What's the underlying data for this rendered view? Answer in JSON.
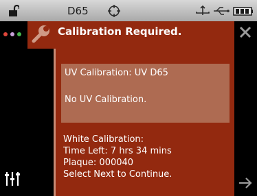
{
  "status_bar": {
    "illuminant": "D65",
    "icons": [
      "unlock-icon",
      "target-icon",
      "usb-icon",
      "usb-plug-icon",
      "battery-icon"
    ]
  },
  "left_rail": {
    "icons": [
      "color-dots-icon",
      "sliders-icon"
    ],
    "dot_colors": [
      "#e0463a",
      "#c7a0d8",
      "#47b64c"
    ]
  },
  "dialog": {
    "title": "Calibration Required.",
    "icon": "wrench-icon",
    "uv_box": {
      "line1": "UV Calibration: UV D65",
      "line2": "No UV Calibration."
    },
    "white_calibration": {
      "heading": "White Calibration:",
      "time_left": "Time Left: 7 hrs 34 mins",
      "plaque": "Plaque: 000040",
      "instruction": "Select Next to Continue."
    }
  },
  "right_rail": {
    "icons": [
      "close-icon",
      "next-arrow-icon"
    ]
  },
  "colors": {
    "dialog_bg": "#93290f",
    "uv_box_bg": "#ae6b52",
    "status_bar": "#bdbdbd"
  }
}
